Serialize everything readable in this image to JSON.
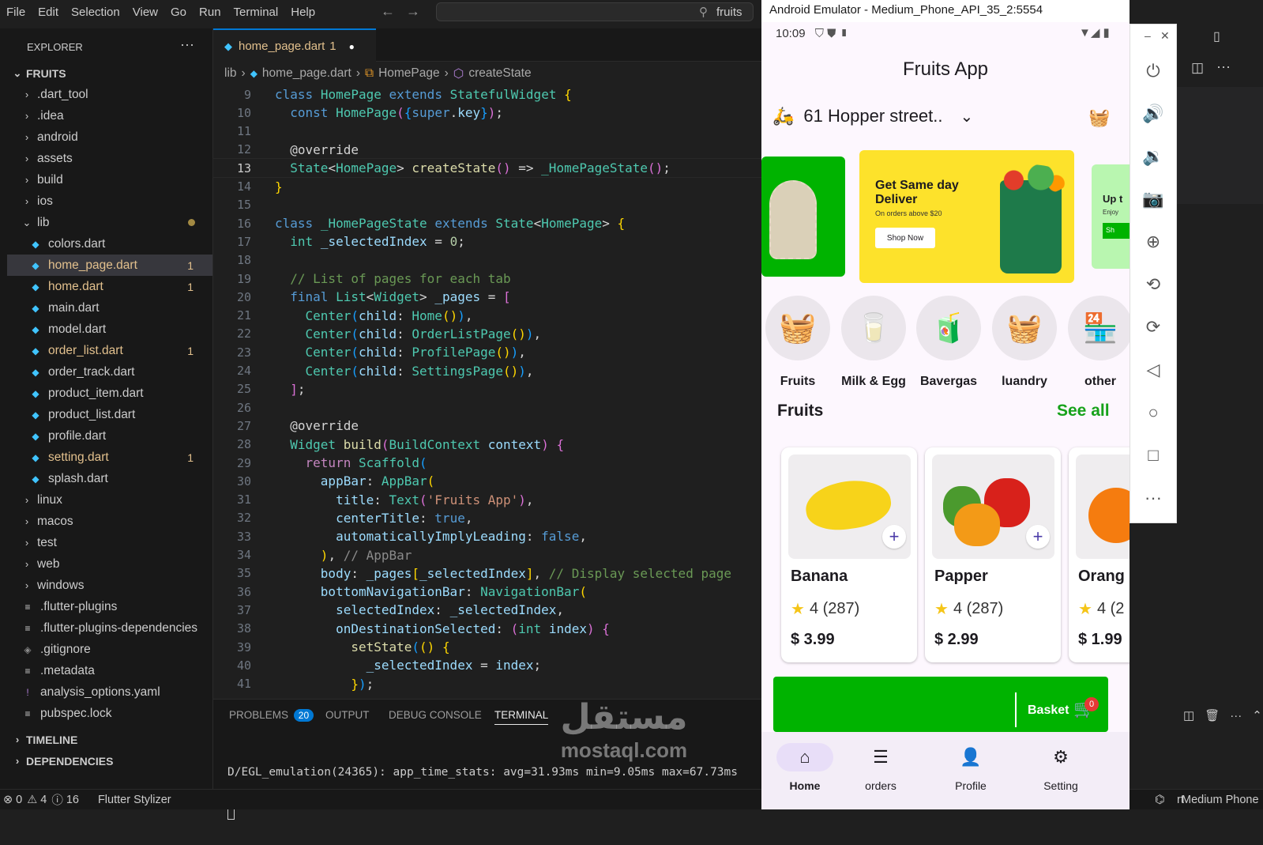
{
  "menubar": {
    "items": [
      "File",
      "Edit",
      "Selection",
      "View",
      "Go",
      "Run",
      "Terminal",
      "Help"
    ],
    "search": "fruits"
  },
  "explorer": {
    "header": "EXPLORER",
    "root": "FRUITS",
    "items": [
      {
        "label": ".dart_tool",
        "type": "folder"
      },
      {
        "label": ".idea",
        "type": "folder"
      },
      {
        "label": "android",
        "type": "folder"
      },
      {
        "label": "assets",
        "type": "folder"
      },
      {
        "label": "build",
        "type": "folder"
      },
      {
        "label": "ios",
        "type": "folder"
      },
      {
        "label": "lib",
        "type": "folder-open"
      },
      {
        "label": "colors.dart",
        "type": "dart"
      },
      {
        "label": "home_page.dart",
        "type": "dart",
        "badge": "1"
      },
      {
        "label": "home.dart",
        "type": "dart",
        "badge": "1"
      },
      {
        "label": "main.dart",
        "type": "dart"
      },
      {
        "label": "model.dart",
        "type": "dart"
      },
      {
        "label": "order_list.dart",
        "type": "dart",
        "badge": "1"
      },
      {
        "label": "order_track.dart",
        "type": "dart"
      },
      {
        "label": "product_item.dart",
        "type": "dart"
      },
      {
        "label": "product_list.dart",
        "type": "dart"
      },
      {
        "label": "profile.dart",
        "type": "dart"
      },
      {
        "label": "setting.dart",
        "type": "dart",
        "badge": "1"
      },
      {
        "label": "splash.dart",
        "type": "dart"
      },
      {
        "label": "linux",
        "type": "folder"
      },
      {
        "label": "macos",
        "type": "folder"
      },
      {
        "label": "test",
        "type": "folder"
      },
      {
        "label": "web",
        "type": "folder"
      },
      {
        "label": "windows",
        "type": "folder"
      },
      {
        "label": ".flutter-plugins",
        "type": "file"
      },
      {
        "label": ".flutter-plugins-dependencies",
        "type": "file"
      },
      {
        "label": ".gitignore",
        "type": "git"
      },
      {
        "label": ".metadata",
        "type": "file"
      },
      {
        "label": "analysis_options.yaml",
        "type": "yaml"
      },
      {
        "label": "pubspec.lock",
        "type": "file"
      }
    ],
    "timeline": "TIMELINE",
    "dependencies": "DEPENDENCIES"
  },
  "editor": {
    "tab": {
      "label": "home_page.dart",
      "badge": "1"
    },
    "breadcrumb": [
      "lib",
      "home_page.dart",
      "HomePage",
      "createState"
    ]
  },
  "panel": {
    "tabs": [
      "PROBLEMS",
      "OUTPUT",
      "DEBUG CONSOLE",
      "TERMINAL"
    ],
    "problems_count": "20",
    "terminal_line": "D/EGL_emulation(24365): app_time_stats: avg=31.93ms min=9.05ms max=67.73ms"
  },
  "statusbar": {
    "errors": "0",
    "warnings": "4",
    "infos": "16",
    "extension": "Flutter Stylizer",
    "device": "Medium Phone",
    "rt": "rt"
  },
  "emulator": {
    "title": "Android Emulator - Medium_Phone_API_35_2:5554",
    "time": "10:09",
    "app_title": "Fruits App",
    "address": "61 Hopper street..",
    "banner": {
      "heading": "Get Same day Deliver",
      "sub": "On orders above $20",
      "button": "Shop Now",
      "peek": "Up t",
      "peek_sub": "Enjoy",
      "peek_btn": "Sh"
    },
    "categories": [
      "Fruits",
      "Milk & Egg",
      "Bavergas",
      "luandry",
      "other"
    ],
    "section_title": "Fruits",
    "see_all": "See all",
    "products": [
      {
        "name": "Banana",
        "rating": "4 (287)",
        "price": "$ 3.99"
      },
      {
        "name": "Papper",
        "rating": "4 (287)",
        "price": "$ 2.99"
      },
      {
        "name": "Orang",
        "rating": "4 (2",
        "price": "$ 1.99"
      }
    ],
    "basket": {
      "label": "Basket",
      "count": "0"
    },
    "nav": [
      "Home",
      "orders",
      "Profile",
      "Setting"
    ]
  },
  "watermark": {
    "arabic": "مستقل",
    "latin": "mostaql.com"
  },
  "colors": {
    "accent": "#0078d4",
    "green": "#00b300",
    "banner_yellow": "#fde22b"
  }
}
